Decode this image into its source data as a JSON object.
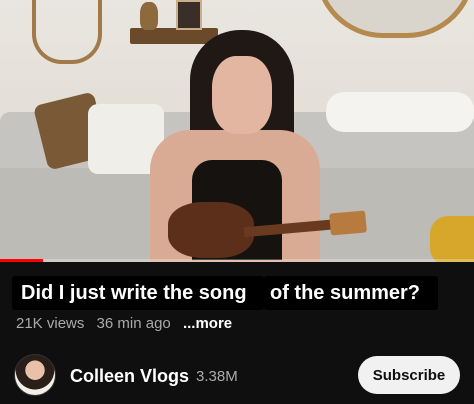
{
  "video": {
    "progress_fraction": 0.09,
    "progress_color": "#ff0000"
  },
  "title": {
    "part1": "Did I just write the song",
    "part2": "of the summer?"
  },
  "meta": {
    "views": "21K views",
    "age": "36 min ago",
    "more": "...more"
  },
  "channel": {
    "name": "Colleen Vlogs",
    "subscribers": "3.38M",
    "subscribe_label": "Subscribe"
  }
}
